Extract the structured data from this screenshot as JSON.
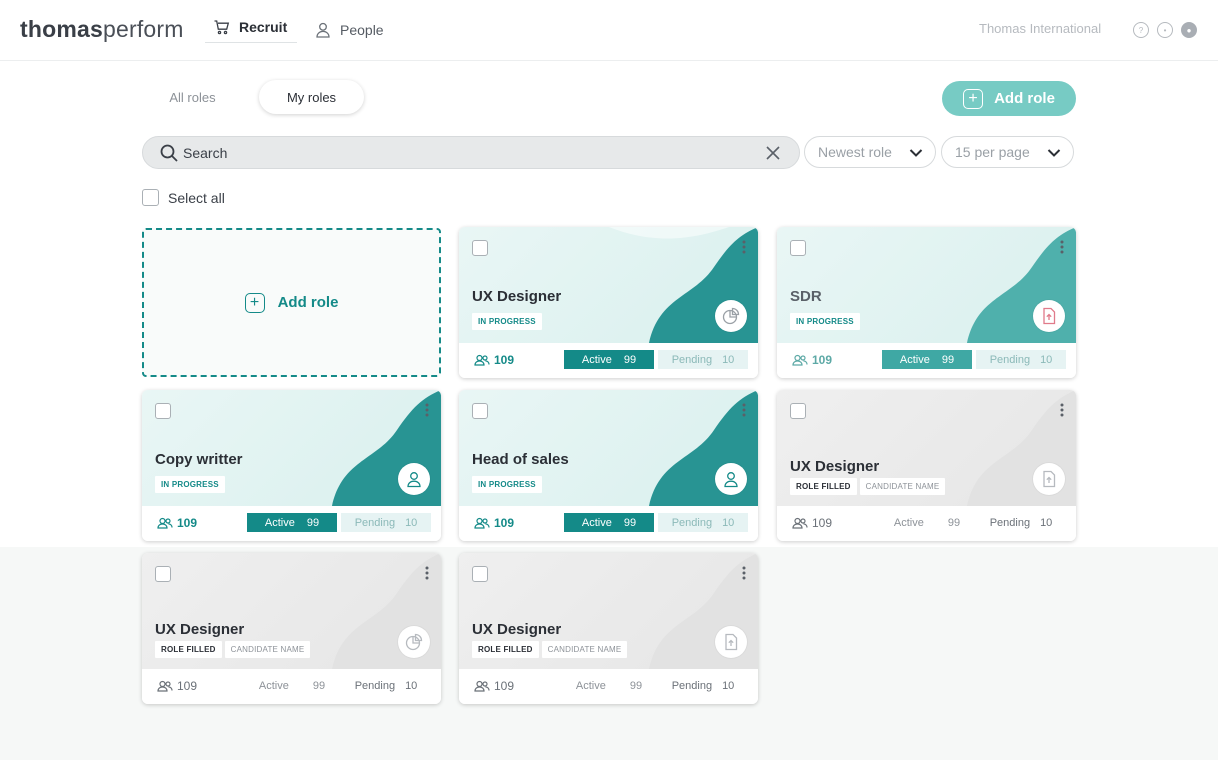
{
  "header": {
    "logo_bold": "thomas",
    "logo_light": "perform",
    "nav": [
      {
        "label": "Recruit",
        "icon": "cart-icon",
        "active": true
      },
      {
        "label": "People",
        "icon": "user-icon",
        "active": false
      }
    ],
    "org_name": "Thomas International",
    "icons": [
      "help-icon",
      "notification-icon",
      "account-icon"
    ]
  },
  "tabs": [
    {
      "label": "All roles",
      "selected": false
    },
    {
      "label": "My roles",
      "selected": true
    }
  ],
  "add_role_label": "Add role",
  "search": {
    "placeholder": "Search",
    "value": ""
  },
  "sort": {
    "selected": "Newest role"
  },
  "per_page": {
    "selected": "15 per page"
  },
  "select_all_label": "Select all",
  "colors": {
    "teal": "#148a88",
    "teal_light": "#77cbc4",
    "pending_bg": "#e6f3f3"
  },
  "cards": [
    {
      "title": "UX Designer",
      "badges": [
        "IN PROGRESS"
      ],
      "icon": "pie-chart-icon",
      "count": "109",
      "active_label": "Active",
      "active": "99",
      "pending_label": "Pending",
      "pending": "10"
    },
    {
      "title": "SDR",
      "badges": [
        "IN PROGRESS"
      ],
      "icon": "file-upload-icon",
      "count": "109",
      "active_label": "Active",
      "active": "99",
      "pending_label": "Pending",
      "pending": "10"
    },
    {
      "title": "Copy writter",
      "badges": [
        "IN PROGRESS"
      ],
      "icon": "person-icon",
      "count": "109",
      "active_label": "Active",
      "active": "99",
      "pending_label": "Pending",
      "pending": "10"
    },
    {
      "title": "Head of sales",
      "badges": [
        "IN PROGRESS"
      ],
      "icon": "person-icon",
      "count": "109",
      "active_label": "Active",
      "active": "99",
      "pending_label": "Pending",
      "pending": "10"
    },
    {
      "title": "UX Designer",
      "badges": [
        "ROLE FILLED",
        "CANDIDATE NAME"
      ],
      "icon": "file-upload-icon",
      "count": "109",
      "active_label": "Active",
      "active": "99",
      "pending_label": "Pending",
      "pending": "10"
    },
    {
      "title": "UX Designer",
      "badges": [
        "ROLE FILLED",
        "CANDIDATE NAME"
      ],
      "icon": "pie-chart-icon",
      "count": "109",
      "active_label": "Active",
      "active": "99",
      "pending_label": "Pending",
      "pending": "10"
    },
    {
      "title": "UX Designer",
      "badges": [
        "ROLE FILLED",
        "CANDIDATE NAME"
      ],
      "icon": "file-upload-icon",
      "count": "109",
      "active_label": "Active",
      "active": "99",
      "pending_label": "Pending",
      "pending": "10"
    }
  ]
}
